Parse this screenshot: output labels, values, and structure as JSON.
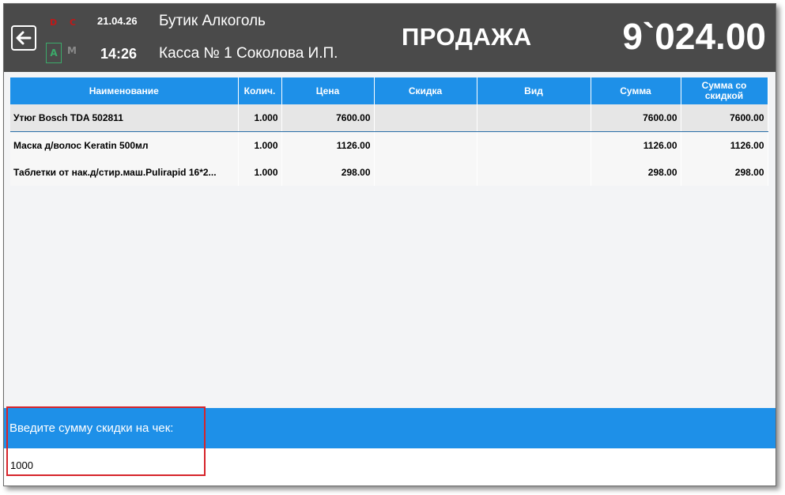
{
  "header": {
    "flags": {
      "d": "D",
      "c": "C",
      "a": "A",
      "m": "M"
    },
    "date": "21.04.26",
    "time": "14:26",
    "shop_name": "Бутик Алкоголь",
    "register": "Касса № 1 Соколова И.П.",
    "mode_title": "ПРОДАЖА",
    "total": "9`024.00",
    "back_icon": "arrow-left-icon"
  },
  "table": {
    "columns": [
      "Наименование",
      "Колич.",
      "Цена",
      "Скидка",
      "Вид",
      "Сумма",
      "Сумма со скидкой"
    ],
    "rows": [
      {
        "name": "Утюг Bosch TDA 502811",
        "qty": "1.000",
        "price": "7600.00",
        "discount": "",
        "kind": "",
        "sum": "7600.00",
        "sum_discount": "7600.00"
      },
      {
        "name": "Маска д/волос Keratin 500мл",
        "qty": "1.000",
        "price": "1126.00",
        "discount": "",
        "kind": "",
        "sum": "1126.00",
        "sum_discount": "1126.00"
      },
      {
        "name": "Таблетки от нак.д/стир.маш.Pulirapid 16*2...",
        "qty": "1.000",
        "price": "298.00",
        "discount": "",
        "kind": "",
        "sum": "298.00",
        "sum_discount": "298.00"
      }
    ]
  },
  "prompt": {
    "label": "Введите сумму скидки на чек:",
    "value": "1000"
  },
  "colors": {
    "header_bg": "#4a4a4a",
    "accent_blue": "#1e90e8",
    "highlight_red": "#d6242a",
    "flag_red": "#c01818",
    "flag_green": "#3caa6a"
  }
}
